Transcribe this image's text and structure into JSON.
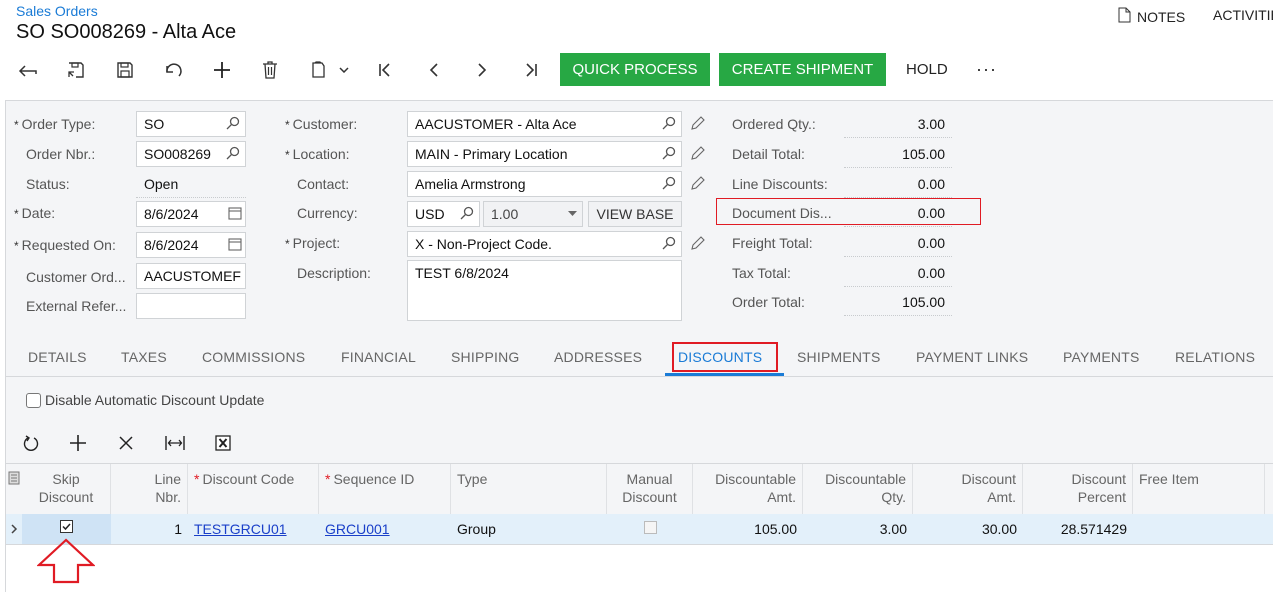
{
  "header": {
    "breadcrumb": "Sales Orders",
    "title": "SO SO008269 - Alta Ace",
    "notes_label": "NOTES",
    "activities_label": "ACTIVITIE"
  },
  "toolbar": {
    "icons": [
      "back-icon",
      "save-close-icon",
      "save-icon",
      "undo-icon",
      "add-icon",
      "delete-icon",
      "copy-paste-icon",
      "first-icon",
      "previous-icon",
      "next-icon",
      "last-icon"
    ],
    "quick_process": "QUICK PROCESS",
    "create_shipment": "CREATE SHIPMENT",
    "hold": "HOLD",
    "more": "···"
  },
  "form": {
    "order_type": {
      "label": "Order Type:",
      "value": "SO",
      "required": true
    },
    "order_nbr": {
      "label": "Order Nbr.:",
      "value": "SO008269"
    },
    "status": {
      "label": "Status:",
      "value": "Open"
    },
    "date": {
      "label": "Date:",
      "value": "8/6/2024",
      "required": true
    },
    "requested_on": {
      "label": "Requested On:",
      "value": "8/6/2024",
      "required": true
    },
    "customer_ord": {
      "label": "Customer Ord...",
      "value": "AACUSTOMEF"
    },
    "external_ref": {
      "label": "External Refer...",
      "value": ""
    },
    "customer": {
      "label": "Customer:",
      "value": "AACUSTOMER - Alta Ace",
      "required": true
    },
    "location": {
      "label": "Location:",
      "value": "MAIN - Primary Location",
      "required": true
    },
    "contact": {
      "label": "Contact:",
      "value": "Amelia Armstrong"
    },
    "currency": {
      "label": "Currency:",
      "value": "USD",
      "rate": "1.00",
      "view_base": "VIEW BASE"
    },
    "project": {
      "label": "Project:",
      "value": "X - Non-Project Code.",
      "required": true
    },
    "description": {
      "label": "Description:",
      "value": "TEST 6/8/2024"
    },
    "required_mark": "*"
  },
  "summary": [
    {
      "label": "Ordered Qty.:",
      "value": "3.00"
    },
    {
      "label": "Detail Total:",
      "value": "105.00"
    },
    {
      "label": "Line Discounts:",
      "value": "0.00"
    },
    {
      "label": "Document Dis...",
      "value": "0.00"
    },
    {
      "label": "Freight Total:",
      "value": "0.00"
    },
    {
      "label": "Tax Total:",
      "value": "0.00"
    },
    {
      "label": "Order Total:",
      "value": "105.00"
    }
  ],
  "tabs": [
    "DETAILS",
    "TAXES",
    "COMMISSIONS",
    "FINANCIAL",
    "SHIPPING",
    "ADDRESSES",
    "DISCOUNTS",
    "SHIPMENTS",
    "PAYMENT LINKS",
    "PAYMENTS",
    "RELATIONS"
  ],
  "active_tab": "DISCOUNTS",
  "discounts": {
    "disable_auto_update": {
      "label": "Disable Automatic Discount Update",
      "checked": false
    },
    "grid_toolbar": [
      "refresh-icon",
      "add-row-icon",
      "delete-row-icon",
      "fit-columns-icon",
      "export-excel-icon"
    ],
    "columns": [
      {
        "l1": "Skip",
        "l2": "Discount"
      },
      {
        "l1": "Line",
        "l2": "Nbr."
      },
      {
        "l1": "Discount Code",
        "l2": "",
        "required": true
      },
      {
        "l1": "Sequence ID",
        "l2": "",
        "required": true
      },
      {
        "l1": "Type",
        "l2": ""
      },
      {
        "l1": "Manual",
        "l2": "Discount"
      },
      {
        "l1": "Discountable",
        "l2": "Amt."
      },
      {
        "l1": "Discountable",
        "l2": "Qty."
      },
      {
        "l1": "Discount",
        "l2": "Amt."
      },
      {
        "l1": "Discount",
        "l2": "Percent"
      },
      {
        "l1": "Free Item",
        "l2": ""
      }
    ],
    "rows": [
      {
        "skip_discount": true,
        "line_nbr": "1",
        "discount_code": "TESTGRCU01",
        "sequence_id": "GRCU001",
        "type": "Group",
        "manual_discount": false,
        "discountable_amt": "105.00",
        "discountable_qty": "3.00",
        "discount_amt": "30.00",
        "discount_percent": "28.571429",
        "free_item": ""
      }
    ]
  },
  "colors": {
    "accent": "#1a7bd6",
    "green_button": "#27a844",
    "highlight_red": "#e01b24",
    "row_selected": "#e3f0fa"
  }
}
